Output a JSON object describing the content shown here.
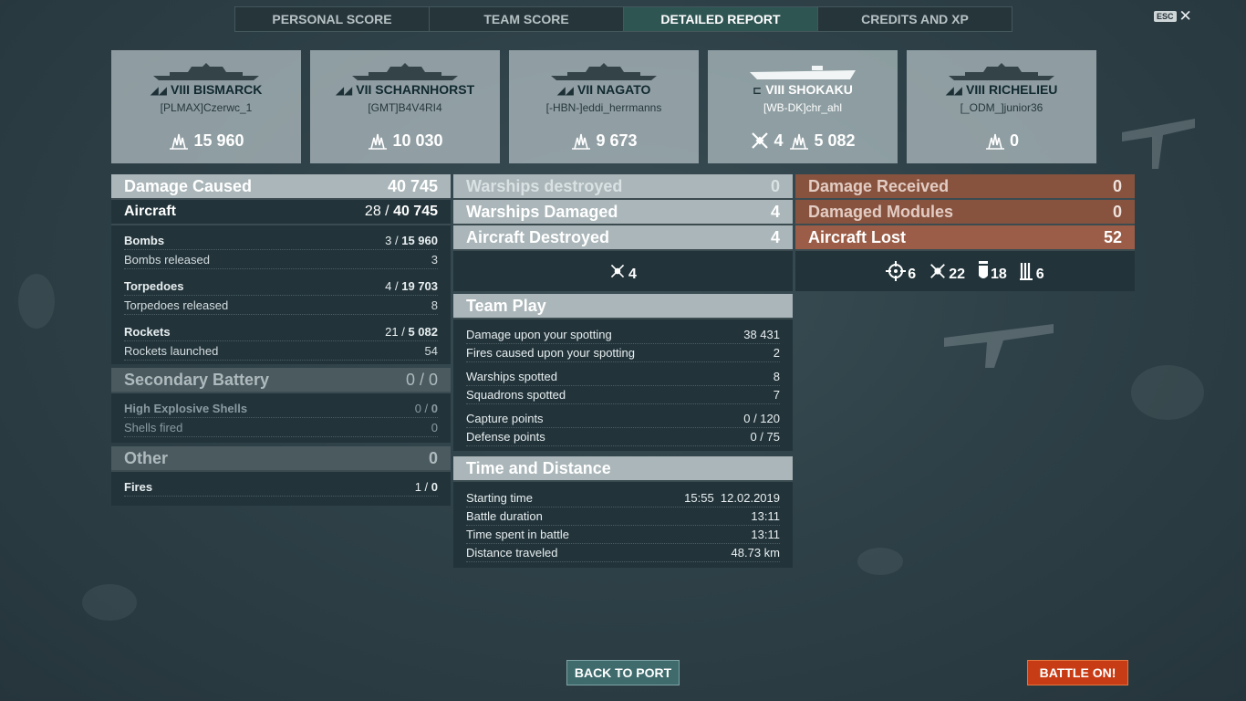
{
  "tabs": [
    {
      "label": "PERSONAL SCORE",
      "active": false
    },
    {
      "label": "TEAM SCORE",
      "active": false
    },
    {
      "label": "DETAILED REPORT",
      "active": true
    },
    {
      "label": "CREDITS AND XP",
      "active": false
    }
  ],
  "esc_label": "ESC",
  "close_glyph": "✕",
  "ships": [
    {
      "tier": "VIII",
      "name": "BISMARCK",
      "player": "[PLMAX]Czerwc_1",
      "damage": "15 960",
      "class_icon": "battleship-icon"
    },
    {
      "tier": "VII",
      "name": "SCHARNHORST",
      "player": "[GMT]B4V4RI4",
      "damage": "10 030",
      "class_icon": "battleship-icon"
    },
    {
      "tier": "VII",
      "name": "NAGATO",
      "player": "[-HBN-]eddi_herrmanns",
      "damage": "9 673",
      "class_icon": "battleship-icon"
    },
    {
      "tier": "VIII",
      "name": "SHOKAKU",
      "player": "[WB-DK]chr_ahl",
      "planes": "4",
      "damage": "5 082",
      "class_icon": "carrier-icon"
    },
    {
      "tier": "VIII",
      "name": "RICHELIEU",
      "player": "[_ODM_]junior36",
      "damage": "0",
      "class_icon": "battleship-icon"
    }
  ],
  "damage_caused": {
    "label": "Damage Caused",
    "value": "40 745",
    "aircraft": {
      "label": "Aircraft",
      "hits": "28",
      "damage": "40 745"
    },
    "rows": [
      {
        "label": "Bombs",
        "hits": "3",
        "damage": "15 960"
      },
      {
        "label": "Bombs released",
        "value": "3"
      },
      {
        "label": "Torpedoes",
        "hits": "4",
        "damage": "19 703"
      },
      {
        "label": "Torpedoes released",
        "value": "8"
      },
      {
        "label": "Rockets",
        "hits": "21",
        "damage": "5 082"
      },
      {
        "label": "Rockets launched",
        "value": "54"
      }
    ],
    "secondary": {
      "label": "Secondary Battery",
      "value": "0 / 0",
      "he_label": "High Explosive Shells",
      "he_hits": "0",
      "he_damage": "0",
      "shells_label": "Shells fired",
      "shells_value": "0"
    },
    "other": {
      "label": "Other",
      "value": "0",
      "fires_label": "Fires",
      "fires_hits": "1",
      "fires_damage": "0"
    }
  },
  "kills": {
    "warships_destroyed": {
      "label": "Warships destroyed",
      "value": "0"
    },
    "warships_damaged": {
      "label": "Warships Damaged",
      "value": "4"
    },
    "aircraft_destroyed": {
      "label": "Aircraft Destroyed",
      "value": "4"
    },
    "plane_kills": "4"
  },
  "team_play": {
    "label": "Team Play",
    "rows": [
      {
        "label": "Damage upon your spotting",
        "value": "38 431"
      },
      {
        "label": "Fires caused upon your spotting",
        "value": "2"
      },
      {
        "label": "Warships spotted",
        "value": "8"
      },
      {
        "label": "Squadrons spotted",
        "value": "7"
      },
      {
        "label": "Capture points",
        "value": "0 / 120"
      },
      {
        "label": "Defense points",
        "value": "0 / 75"
      }
    ]
  },
  "time_distance": {
    "label": "Time and Distance",
    "rows": [
      {
        "label": "Starting time",
        "value": "15:55  12.02.2019"
      },
      {
        "label": "Battle duration",
        "value": "13:11"
      },
      {
        "label": "Time spent in battle",
        "value": "13:11"
      },
      {
        "label": "Distance traveled",
        "value": "48.73 km"
      }
    ]
  },
  "received": {
    "damage_received": {
      "label": "Damage Received",
      "value": "0"
    },
    "damaged_modules": {
      "label": "Damaged Modules",
      "value": "0"
    },
    "aircraft_lost": {
      "label": "Aircraft Lost",
      "value": "52"
    },
    "icons": [
      {
        "icon": "crosshair-icon",
        "value": "6"
      },
      {
        "icon": "plane-kill-icon",
        "value": "22"
      },
      {
        "icon": "bomb-icon",
        "value": "18"
      },
      {
        "icon": "rockets-icon",
        "value": "6"
      }
    ]
  },
  "buttons": {
    "back": "BACK TO PORT",
    "battle": "BATTLE ON!"
  }
}
